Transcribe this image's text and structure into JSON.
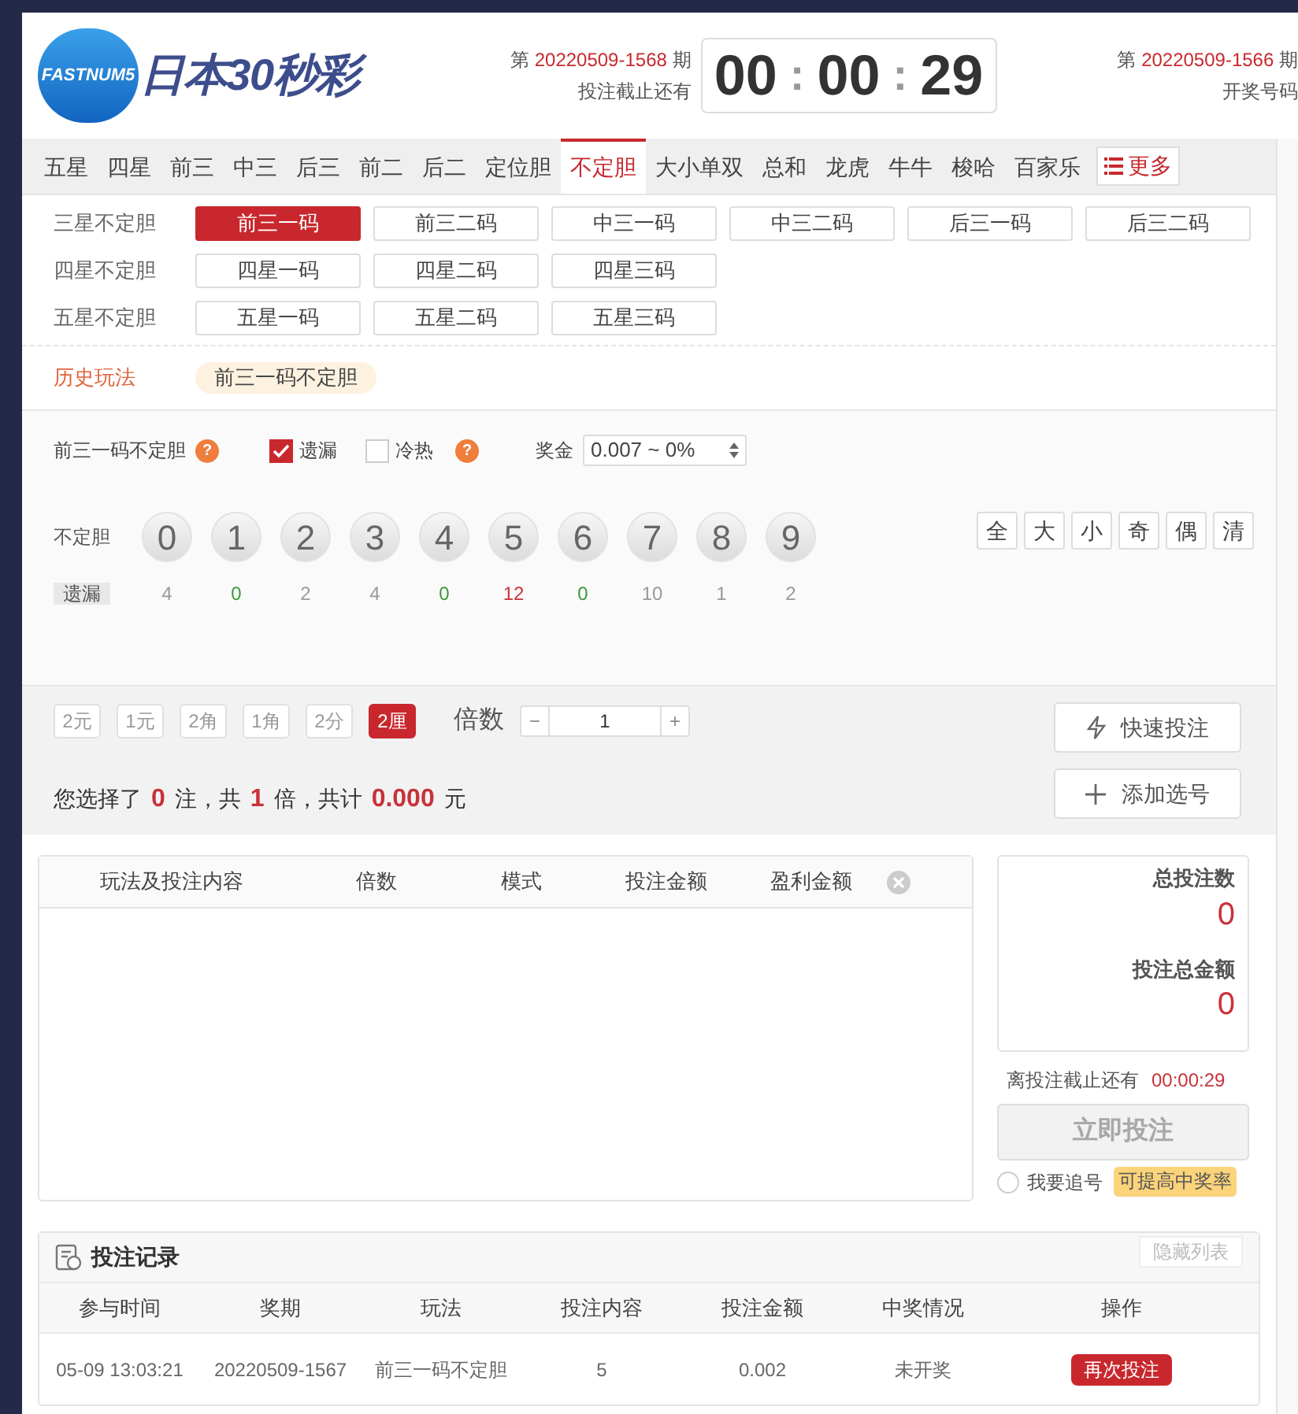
{
  "header": {
    "logo_badge": "FASTNUM5",
    "logo_text": "日本30秒彩",
    "current": {
      "prefix": "第",
      "issue": "20220509-1568",
      "suffix": "期",
      "label": "投注截止还有"
    },
    "countdown": {
      "parts": [
        "00",
        "00",
        "29"
      ],
      "separator": ":"
    },
    "last_draw": {
      "prefix": "第",
      "issue": "20220509-1566",
      "suffix": "期",
      "label": "开奖号码"
    }
  },
  "tabs": [
    {
      "label": "五星",
      "selected": false
    },
    {
      "label": "四星",
      "selected": false
    },
    {
      "label": "前三",
      "selected": false
    },
    {
      "label": "中三",
      "selected": false
    },
    {
      "label": "后三",
      "selected": false
    },
    {
      "label": "前二",
      "selected": false
    },
    {
      "label": "后二",
      "selected": false
    },
    {
      "label": "定位胆",
      "selected": false
    },
    {
      "label": "不定胆",
      "selected": true
    },
    {
      "label": "大小单双",
      "selected": false
    },
    {
      "label": "总和",
      "selected": false
    },
    {
      "label": "龙虎",
      "selected": false
    },
    {
      "label": "牛牛",
      "selected": false
    },
    {
      "label": "梭哈",
      "selected": false
    },
    {
      "label": "百家乐",
      "selected": false
    },
    {
      "label": "更多",
      "selected": false,
      "kind": "menu"
    }
  ],
  "groups": [
    {
      "label": "三星不定胆",
      "options": [
        {
          "label": "前三一码",
          "selected": true
        },
        {
          "label": "前三二码",
          "selected": false
        },
        {
          "label": "中三一码",
          "selected": false
        },
        {
          "label": "中三二码",
          "selected": false
        },
        {
          "label": "后三一码",
          "selected": false
        },
        {
          "label": "后三二码",
          "selected": false
        }
      ]
    },
    {
      "label": "四星不定胆",
      "options": [
        {
          "label": "四星一码",
          "selected": false
        },
        {
          "label": "四星二码",
          "selected": false
        },
        {
          "label": "四星三码",
          "selected": false
        }
      ]
    },
    {
      "label": "五星不定胆",
      "options": [
        {
          "label": "五星一码",
          "selected": false
        },
        {
          "label": "五星二码",
          "selected": false
        },
        {
          "label": "五星三码",
          "selected": false
        }
      ]
    }
  ],
  "history": {
    "label": "历史玩法",
    "items": [
      "前三一码不定胆"
    ]
  },
  "options": {
    "play_name": "前三一码不定胆",
    "help": "?",
    "checkboxes": [
      {
        "label": "遗漏",
        "checked": true
      },
      {
        "label": "冷热",
        "checked": false,
        "help": "?"
      }
    ],
    "bonus_label": "奖金",
    "bonus_value": "0.007 ~ 0%"
  },
  "balls": {
    "row_label": "不定胆",
    "miss_label": "遗漏",
    "items": [
      {
        "number": "0",
        "miss": "4",
        "color": "#999999"
      },
      {
        "number": "1",
        "miss": "0",
        "color": "#3a9a3a"
      },
      {
        "number": "2",
        "miss": "2",
        "color": "#999999"
      },
      {
        "number": "3",
        "miss": "4",
        "color": "#999999"
      },
      {
        "number": "4",
        "miss": "0",
        "color": "#3a9a3a"
      },
      {
        "number": "5",
        "miss": "12",
        "color": "#c8323a"
      },
      {
        "number": "6",
        "miss": "0",
        "color": "#3a9a3a"
      },
      {
        "number": "7",
        "miss": "10",
        "color": "#999999"
      },
      {
        "number": "8",
        "miss": "1",
        "color": "#999999"
      },
      {
        "number": "9",
        "miss": "2",
        "color": "#999999"
      }
    ],
    "quick": [
      "全",
      "大",
      "小",
      "奇",
      "偶",
      "清"
    ]
  },
  "bet": {
    "units": [
      {
        "label": "2元",
        "selected": false
      },
      {
        "label": "1元",
        "selected": false
      },
      {
        "label": "2角",
        "selected": false
      },
      {
        "label": "1角",
        "selected": false
      },
      {
        "label": "2分",
        "selected": false
      },
      {
        "label": "2厘",
        "selected": true
      }
    ],
    "multiplier_label": "倍数",
    "minus": "−",
    "multiplier": "1",
    "plus": "+",
    "summary": [
      {
        "text": "您选择了",
        "kind": "plain"
      },
      {
        "text": "0",
        "kind": "value"
      },
      {
        "text": "注，共",
        "kind": "plain"
      },
      {
        "text": "1",
        "kind": "value"
      },
      {
        "text": "倍，共计",
        "kind": "plain"
      },
      {
        "text": "0.000",
        "kind": "value"
      },
      {
        "text": "元",
        "kind": "plain"
      }
    ],
    "quick_bet": "快速投注",
    "add": "添加选号"
  },
  "cart": {
    "columns": [
      "玩法及投注内容",
      "倍数",
      "模式",
      "投注金额",
      "盈利金额"
    ]
  },
  "totals": {
    "count_label": "总投注数",
    "count": "0",
    "amount_label": "投注总金额",
    "amount": "0",
    "deadline_label": "离投注截止还有",
    "deadline": "00:00:29",
    "submit": "立即投注",
    "submit_disabled": true,
    "chase_label": "我要追号",
    "chase_checked": false,
    "chase_badge": "可提高中奖率"
  },
  "records": {
    "title": "投注记录",
    "hide": "隐藏列表",
    "columns": [
      "参与时间",
      "奖期",
      "玩法",
      "投注内容",
      "投注金额",
      "中奖情况",
      "操作"
    ],
    "rows": [
      {
        "cells": [
          "05-09 13:03:21",
          "20220509-1567",
          "前三一码不定胆",
          "5",
          "0.002",
          "未开奖"
        ],
        "action": "再次投注"
      }
    ]
  }
}
